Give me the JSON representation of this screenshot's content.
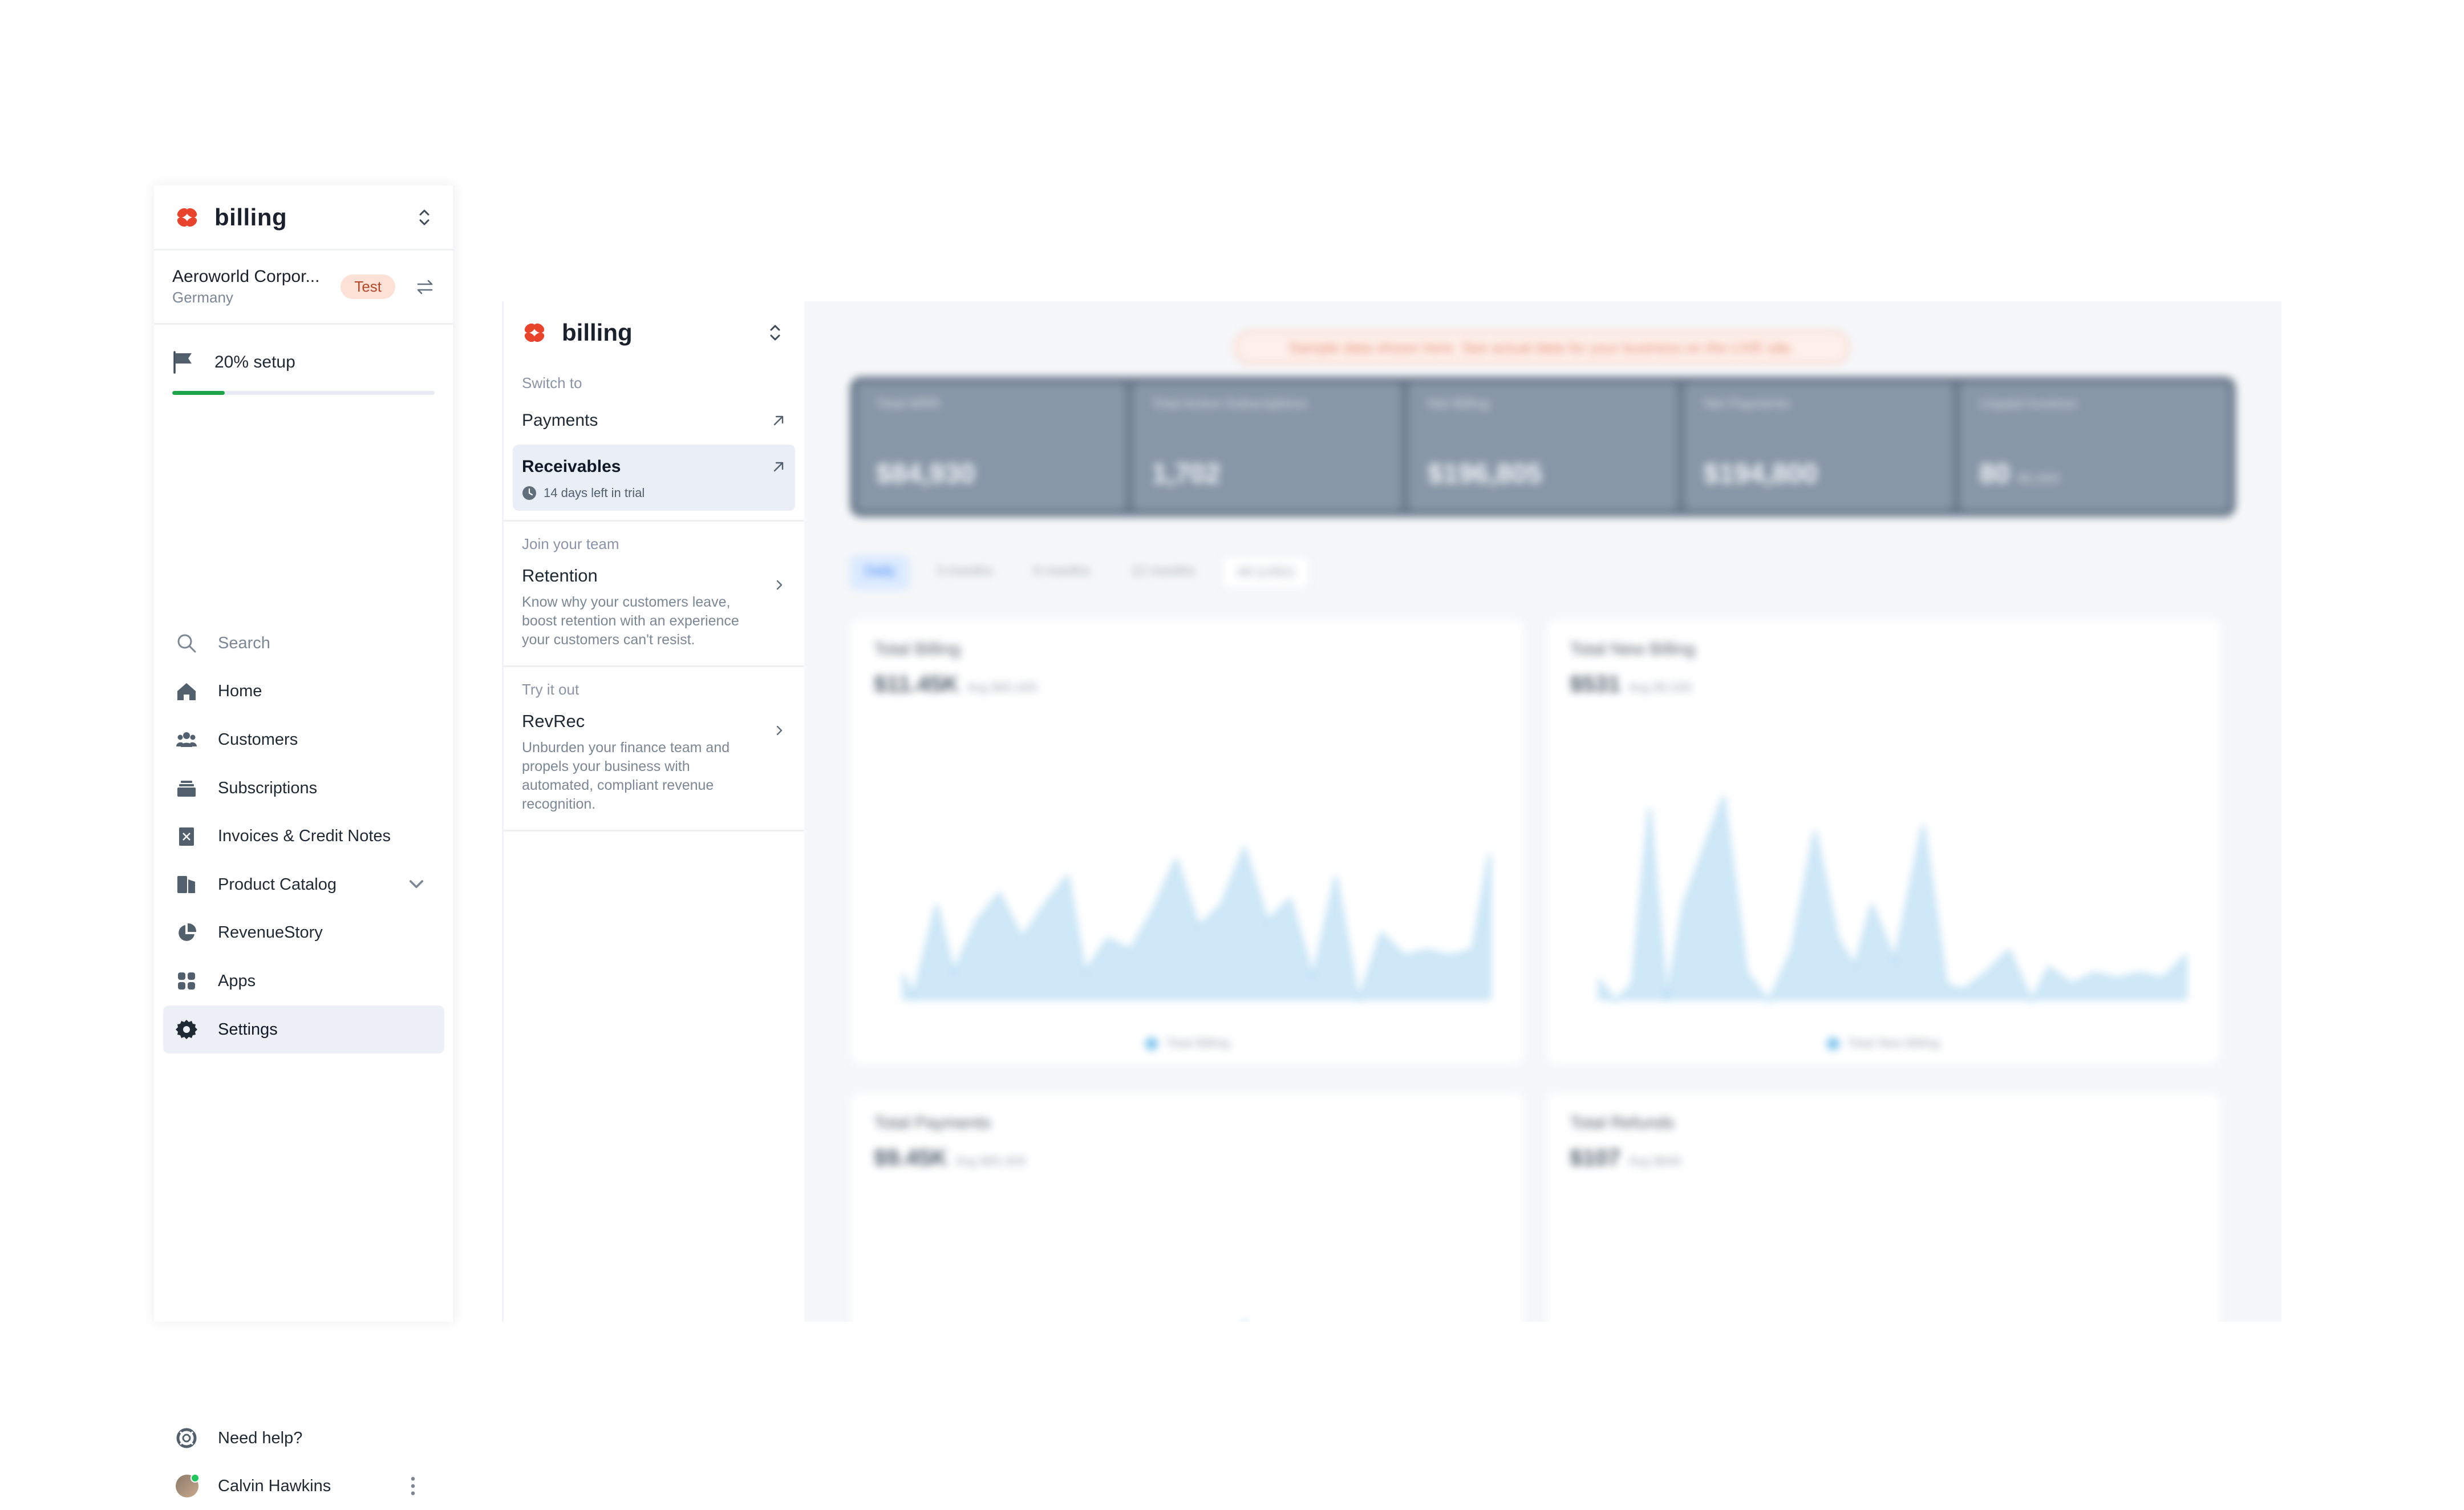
{
  "sidebar": {
    "brand": "billing",
    "org_name": "Aeroworld Corpor...",
    "org_country": "Germany",
    "badge": "Test",
    "setup_label": "20% setup",
    "setup_progress_pct": 20,
    "nav": [
      {
        "label": "Search",
        "icon": "search-icon"
      },
      {
        "label": "Home",
        "icon": "home-icon"
      },
      {
        "label": "Customers",
        "icon": "customers-icon"
      },
      {
        "label": "Subscriptions",
        "icon": "subscriptions-icon"
      },
      {
        "label": "Invoices & Credit Notes",
        "icon": "invoice-icon"
      },
      {
        "label": "Product Catalog",
        "icon": "product-catalog-icon"
      },
      {
        "label": "RevenueStory",
        "icon": "pie-chart-icon"
      },
      {
        "label": "Apps",
        "icon": "apps-grid-icon"
      },
      {
        "label": "Settings",
        "icon": "gear-icon"
      }
    ],
    "active": "Settings",
    "help_label": "Need help?",
    "user_name": "Calvin Hawkins"
  },
  "panel": {
    "brand": "billing",
    "switch_to": "Switch to",
    "payments": "Payments",
    "receivables": "Receivables",
    "trial": "14 days left in trial",
    "join_team": "Join your team",
    "retention_title": "Retention",
    "retention_desc": "Know why your customers leave, boost retention with an experience your customers can't resist.",
    "try_it_out": "Try it out",
    "revrec_title": "RevRec",
    "revrec_desc": "Unburden your finance team and propels your business with automated, compliant revenue recognition."
  },
  "main": {
    "notice": "Sample data shown here. See actual data for your business on the LIVE site.",
    "kpis": [
      {
        "label": "Total MRR",
        "value": "$84,930",
        "sub": ""
      },
      {
        "label": "Total Active Subscriptions",
        "value": "1,702",
        "sub": ""
      },
      {
        "label": "Net Billing",
        "value": "$196,805",
        "sub": ""
      },
      {
        "label": "Net Payments",
        "value": "$194,800",
        "sub": ""
      },
      {
        "label": "Unpaid Invoices",
        "value": "80",
        "sub": "$5,000"
      }
    ],
    "tabs": [
      "Daily",
      "3 months",
      "6 months",
      "12 months",
      "All (USD)"
    ],
    "cards": [
      {
        "title": "Total Billing",
        "value": "$11.45K",
        "sub": "Avg $65,409",
        "legend": "Total Billing"
      },
      {
        "title": "Total New Billing",
        "value": "$531",
        "sub": "Avg $5,026",
        "legend": "Total New Billing"
      },
      {
        "title": "Total Payments",
        "value": "$9.45K",
        "sub": "Avg $65,409",
        "legend": ""
      },
      {
        "title": "Total Refunds",
        "value": "$107",
        "sub": "Avg $846",
        "legend": ""
      }
    ],
    "colors": {
      "area_fill": "#cfe8f7",
      "area_stroke": "#a9d6f0",
      "accent_orange": "#e8442c"
    }
  }
}
